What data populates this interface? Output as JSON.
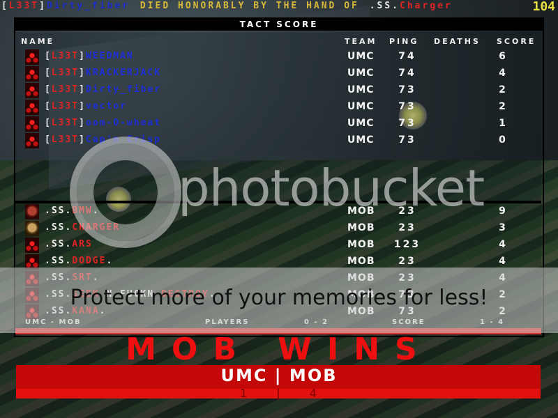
{
  "kill_message": {
    "victim_clan_open": "[",
    "victim_clan": "L33T",
    "victim_clan_close": "]",
    "victim_name": "Dirty_fiber",
    "text": "DIED HONORABLY BY THE HAND OF",
    "killer_prefix": ".SS.",
    "killer_name": "Charger"
  },
  "frag_count": "104",
  "scoreboard": {
    "title": "TACT SCORE",
    "headers": {
      "name": "NAME",
      "team": "TEAM",
      "ping": "PING",
      "deaths": "DEATHS",
      "score": "SCORE"
    },
    "team_umc": [
      {
        "clan": "L33T",
        "name": "WEEDMAN",
        "team": "UMC",
        "ping": "74",
        "deaths": "",
        "score": "6"
      },
      {
        "clan": "L33T",
        "name": "KRACKERJACK",
        "team": "UMC",
        "ping": "74",
        "deaths": "",
        "score": "4"
      },
      {
        "clan": "L33T",
        "name": "Dirty_fiber",
        "team": "UMC",
        "ping": "73",
        "deaths": "",
        "score": "2"
      },
      {
        "clan": "L33T",
        "name": "vector",
        "team": "UMC",
        "ping": "73",
        "deaths": "",
        "score": "2"
      },
      {
        "clan": "L33T",
        "name": "oom-O-wheat",
        "team": "UMC",
        "ping": "73",
        "deaths": "",
        "score": "1"
      },
      {
        "clan": "L33T",
        "name": "Cap'n Crisp",
        "team": "UMC",
        "ping": "73",
        "deaths": "",
        "score": "0"
      }
    ],
    "team_mob": [
      {
        "prefix": ".SS.",
        "name": "BMW",
        "suffix": ".",
        "team": "MOB",
        "ping": "23",
        "deaths": "",
        "score": "9"
      },
      {
        "prefix": ".SS.",
        "name": "CHARGER",
        "suffix": "",
        "team": "MOB",
        "ping": "23",
        "deaths": "",
        "score": "3"
      },
      {
        "prefix": ".SS.",
        "name": "ARS",
        "suffix": "",
        "team": "MOB",
        "ping": "123",
        "deaths": "",
        "score": "4"
      },
      {
        "prefix": ".SS.",
        "name": "DODGE",
        "suffix": ".",
        "team": "MOB",
        "ping": "23",
        "deaths": "",
        "score": "4"
      },
      {
        "prefix": ".SS.",
        "name": "SRT",
        "suffix": ".",
        "team": "MOB",
        "ping": "23",
        "deaths": "",
        "score": "4"
      },
      {
        "prefix": ".SS.",
        "name_red1": "SEEK",
        "name_white": "N FUCKN",
        "name_red2": "DESTROY",
        "suffix": ".",
        "team": "MOB",
        "ping": "73",
        "deaths": "",
        "score": "2"
      },
      {
        "prefix": ".SS.",
        "name": "KANA",
        "suffix": ".",
        "team": "MOB",
        "ping": "73",
        "deaths": "",
        "score": "2"
      }
    ],
    "summary": {
      "teams": "UMC - MOB",
      "players_label": "PLAYERS",
      "players_value": "0 - 2",
      "score_label": "SCORE",
      "score_value": "1 - 4"
    }
  },
  "result": {
    "winner_text": "MOB WINS",
    "teams_line": "UMC | MOB",
    "score_a": "1",
    "score_sep": "|",
    "score_b": "4"
  },
  "watermark": {
    "brand": "photobucket",
    "tagline": "Protect more of your memories for less!"
  },
  "colors": {
    "clan_red": "#e02424",
    "umc_blue": "#1c2cd8",
    "announce_gold": "#d8b83a",
    "win_red": "#ee1010",
    "bar_red": "#c40808"
  }
}
